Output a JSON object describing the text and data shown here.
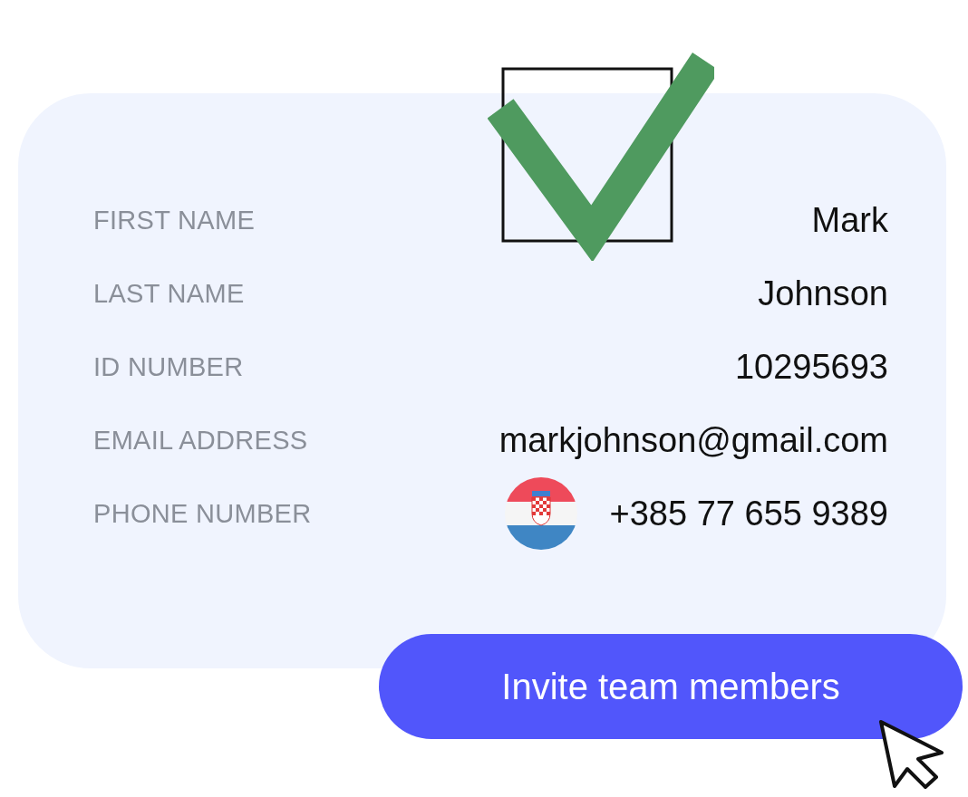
{
  "checkbox": {
    "checked": true
  },
  "fields": [
    {
      "kind": "text",
      "label": "FIRST NAME",
      "value": "Mark"
    },
    {
      "kind": "text",
      "label": "LAST NAME",
      "value": "Johnson"
    },
    {
      "kind": "text",
      "label": "ID NUMBER",
      "value": "10295693"
    },
    {
      "kind": "text",
      "label": "EMAIL ADDRESS",
      "value": "markjohnson@gmail.com"
    },
    {
      "kind": "phone",
      "label": "PHONE NUMBER",
      "value": "+385 77 655 9389"
    }
  ],
  "button": {
    "label": "Invite team members"
  }
}
